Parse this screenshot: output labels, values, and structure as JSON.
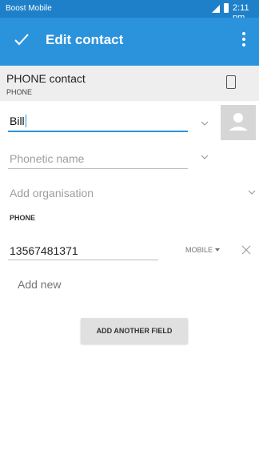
{
  "status_bar": {
    "carrier": "Boost Mobile",
    "time": "2:11 pm"
  },
  "app_bar": {
    "title": "Edit contact",
    "confirm_icon": "check-icon",
    "overflow_icon": "more-vert-icon"
  },
  "account": {
    "name": "PHONE contact",
    "type": "PHONE",
    "icon": "phone-device-icon"
  },
  "fields": {
    "name_value": "Bill",
    "phonetic_placeholder": "Phonetic name",
    "organisation_placeholder": "Add organisation"
  },
  "phone_section": {
    "header": "PHONE",
    "number": "13567481371",
    "type": "MOBILE",
    "add_new": "Add new"
  },
  "buttons": {
    "add_another_field": "ADD ANOTHER FIELD"
  },
  "colors": {
    "status_bar": "#1e80c8",
    "app_bar": "#2b93dc",
    "accent": "#2b93dc"
  }
}
